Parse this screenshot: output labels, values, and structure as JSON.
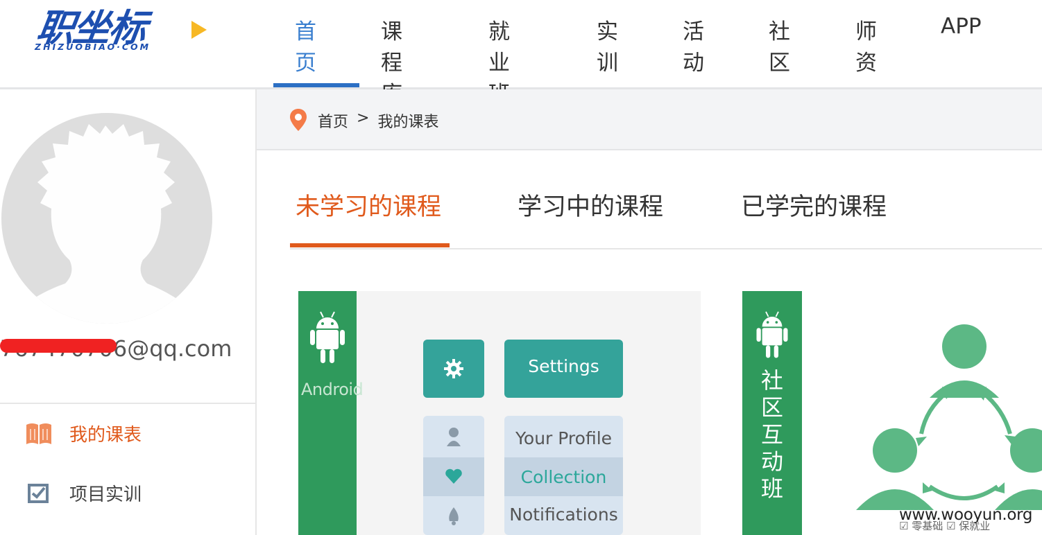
{
  "header": {
    "logo_text": "职坐标",
    "logo_sub": "ZHIZUOBIAO·COM",
    "nav": [
      "首页",
      "课程库",
      "就业班",
      "实训",
      "活动",
      "社区",
      "师资",
      "APP"
    ],
    "active_nav": "首页"
  },
  "sidebar": {
    "email": "767470706@qq.com",
    "items": [
      {
        "label": "我的课表",
        "icon": "book-icon",
        "active": true
      },
      {
        "label": "项目实训",
        "icon": "checkbox-icon",
        "active": false
      }
    ]
  },
  "breadcrumb": {
    "home": "首页",
    "separator": ">",
    "current": "我的课表"
  },
  "tabs": [
    "未学习的课程",
    "学习中的课程",
    "已学完的课程"
  ],
  "cards": [
    {
      "platform": "Android",
      "settings_label": "Settings",
      "menu": [
        "Your Profile",
        "Collection",
        "Notifications"
      ]
    },
    {
      "vertical_title": [
        "社",
        "区",
        "互",
        "动",
        "班"
      ]
    }
  ],
  "watermark": "www.wooyun.org",
  "watermark_sub": "☑ 零基础   ☑ 保就业",
  "colors": {
    "nav_active": "#3a7fcf",
    "accent_orange": "#e05a1c",
    "card_green": "#2f9a5c",
    "people_green": "#5cb885",
    "teal_tile": "#34a39a"
  }
}
